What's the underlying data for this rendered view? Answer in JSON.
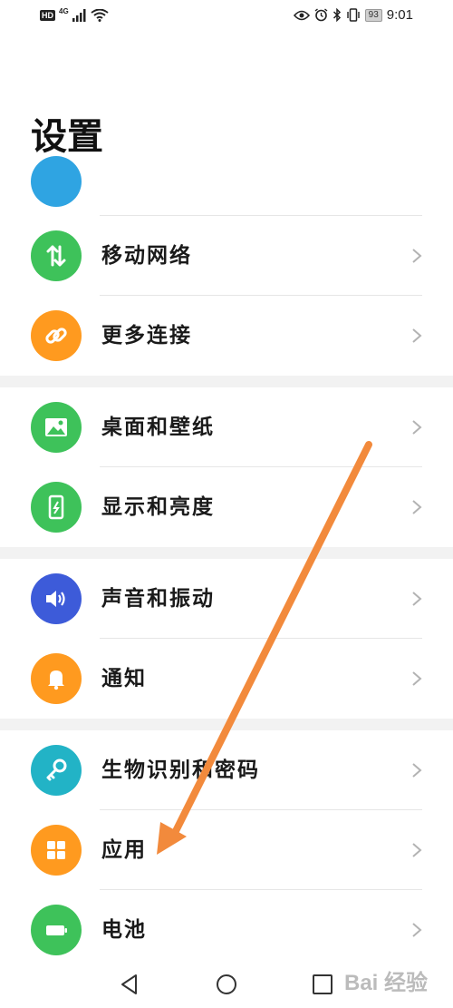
{
  "status_bar": {
    "hd_badge": "HD",
    "network_label": "4G",
    "battery_percent": "93",
    "time": "9:01"
  },
  "page": {
    "title": "设置"
  },
  "settings": {
    "items": [
      {
        "label": "移动网络",
        "icon": "mobile-data-icon",
        "color": "#3ec25a"
      },
      {
        "label": "更多连接",
        "icon": "link-icon",
        "color": "#ff9a1f"
      },
      {
        "label": "桌面和壁纸",
        "icon": "image-icon",
        "color": "#3ec25a"
      },
      {
        "label": "显示和亮度",
        "icon": "phone-display-icon",
        "color": "#3ec25a"
      },
      {
        "label": "声音和振动",
        "icon": "speaker-icon",
        "color": "#3d5bd9"
      },
      {
        "label": "通知",
        "icon": "bell-icon",
        "color": "#ff9a1f"
      },
      {
        "label": "生物识别和密码",
        "icon": "key-icon",
        "color": "#22b3c6"
      },
      {
        "label": "应用",
        "icon": "apps-grid-icon",
        "color": "#ff9a1f"
      },
      {
        "label": "电池",
        "icon": "battery-icon",
        "color": "#3ec25a"
      }
    ]
  },
  "watermark": "Bai 经验",
  "colors": {
    "annotation_arrow": "#f28a3c",
    "chevron": "#b3b3b3"
  }
}
